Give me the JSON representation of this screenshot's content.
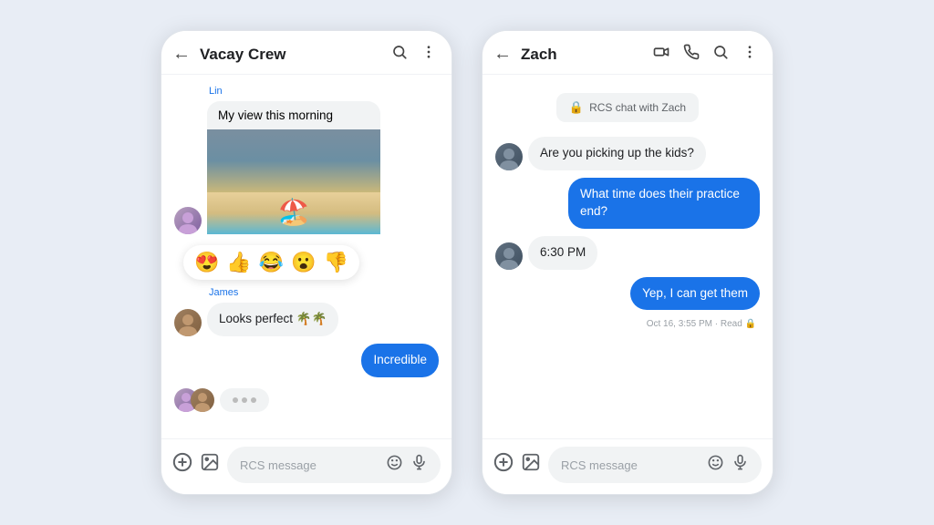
{
  "phone1": {
    "header": {
      "back": "←",
      "title": "Vacay Crew",
      "search_icon": "🔍",
      "menu_icon": "⋮"
    },
    "messages": [
      {
        "sender": "Lin",
        "text": "My view this morning",
        "type": "image-text"
      },
      {
        "type": "reactions",
        "emojis": [
          "😍",
          "👍",
          "😂",
          "😮",
          "👎"
        ]
      },
      {
        "sender": "James",
        "text": "Looks perfect 🌴🌴",
        "type": "incoming"
      },
      {
        "text": "Incredible",
        "type": "outgoing"
      }
    ],
    "input": {
      "placeholder": "RCS message",
      "emoji_icon": "😊",
      "mic_icon": "🎤",
      "plus_icon": "＋",
      "image_icon": "🖼"
    }
  },
  "phone2": {
    "header": {
      "back": "←",
      "title": "Zach",
      "video_icon": "📹",
      "phone_icon": "📞",
      "search_icon": "🔍",
      "menu_icon": "⋮"
    },
    "rcs_badge": "RCS chat with Zach",
    "messages": [
      {
        "text": "Are you picking up the kids?",
        "type": "incoming"
      },
      {
        "text": "What time does their practice end?",
        "type": "outgoing"
      },
      {
        "text": "6:30 PM",
        "type": "incoming"
      },
      {
        "text": "Yep, I can get them",
        "type": "outgoing"
      }
    ],
    "timestamp": "Oct 16, 3:55 PM · Read 🔒",
    "input": {
      "placeholder": "RCS message",
      "emoji_icon": "😊",
      "mic_icon": "🎤",
      "plus_icon": "＋",
      "image_icon": "🖼"
    }
  }
}
